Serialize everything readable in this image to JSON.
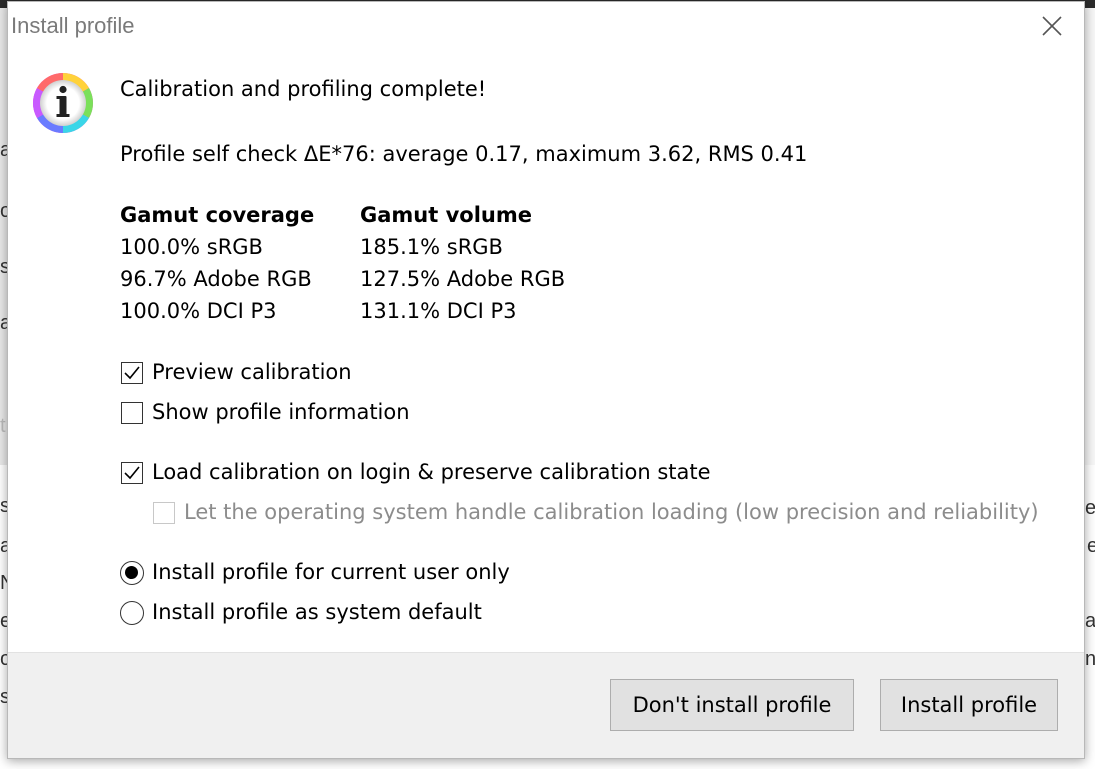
{
  "window": {
    "title": "Install profile"
  },
  "message": {
    "headline": "Calibration and profiling complete!",
    "self_check": "Profile self check ΔE*76: average 0.17, maximum 3.62, RMS 0.41"
  },
  "gamut": {
    "coverage_header": "Gamut coverage",
    "volume_header": "Gamut volume",
    "coverage": [
      "100.0% sRGB",
      "96.7% Adobe RGB",
      "100.0% DCI P3"
    ],
    "volume": [
      "185.1% sRGB",
      "127.5% Adobe RGB",
      "131.1% DCI P3"
    ]
  },
  "options": {
    "preview_calibration": {
      "label": "Preview calibration",
      "checked": true
    },
    "show_profile_info": {
      "label": "Show profile information",
      "checked": false
    },
    "load_calibration": {
      "label": "Load calibration on login & preserve calibration state",
      "checked": true
    },
    "os_handle_loading": {
      "label": "Let the operating system handle calibration loading (low precision and reliability)",
      "checked": false,
      "enabled": false
    }
  },
  "install_scope": {
    "current_user": {
      "label": "Install profile for current user only",
      "selected": true
    },
    "system_default": {
      "label": "Install profile as system default",
      "selected": false
    }
  },
  "buttons": {
    "dont_install": "Don't install profile",
    "install": "Install profile"
  },
  "background_fragments": {
    "left": [
      "a",
      "o",
      "s",
      "a",
      "t",
      "s",
      "a",
      "N",
      "e",
      "o",
      "s"
    ],
    "right": [
      "el",
      "e",
      "ay",
      "ne"
    ]
  },
  "colors": {
    "dialog_bg": "#ffffff",
    "footer_bg": "#f0f0f0",
    "button_bg": "#e1e1e1",
    "title_text": "#7a7a7a",
    "disabled_text": "#8c8c8c"
  }
}
